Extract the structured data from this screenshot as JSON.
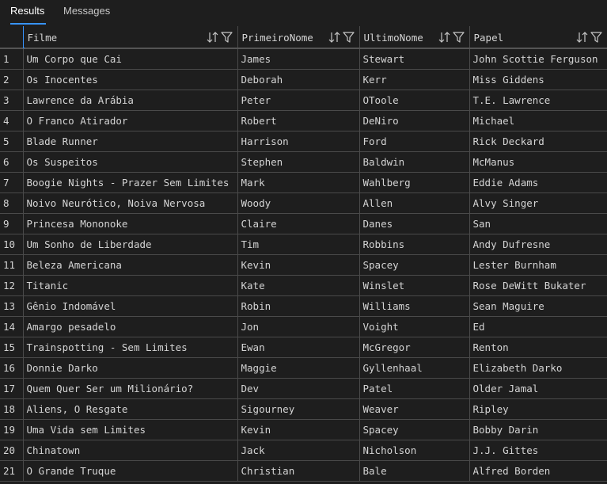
{
  "tabs": {
    "results": "Results",
    "messages": "Messages"
  },
  "columns": [
    "Filme",
    "PrimeiroNome",
    "UltimoNome",
    "Papel"
  ],
  "rows": [
    [
      "1",
      "Um Corpo que Cai",
      "James",
      "Stewart",
      "John Scottie Ferguson"
    ],
    [
      "2",
      "Os Inocentes",
      "Deborah",
      "Kerr",
      "Miss Giddens"
    ],
    [
      "3",
      "Lawrence da Arábia",
      "Peter",
      "OToole",
      "T.E. Lawrence"
    ],
    [
      "4",
      "O Franco Atirador",
      "Robert",
      "DeNiro",
      "Michael"
    ],
    [
      "5",
      "Blade Runner",
      "Harrison",
      "Ford",
      "Rick Deckard"
    ],
    [
      "6",
      "Os Suspeitos",
      "Stephen",
      "Baldwin",
      "McManus"
    ],
    [
      "7",
      "Boogie Nights - Prazer Sem Limites",
      "Mark",
      "Wahlberg",
      "Eddie Adams"
    ],
    [
      "8",
      "Noivo Neurótico, Noiva Nervosa",
      "Woody",
      "Allen",
      "Alvy Singer"
    ],
    [
      "9",
      "Princesa Mononoke",
      "Claire",
      "Danes",
      "San"
    ],
    [
      "10",
      "Um Sonho de Liberdade",
      "Tim",
      "Robbins",
      "Andy Dufresne"
    ],
    [
      "11",
      "Beleza Americana",
      "Kevin",
      "Spacey",
      "Lester Burnham"
    ],
    [
      "12",
      "Titanic",
      "Kate",
      "Winslet",
      "Rose DeWitt Bukater"
    ],
    [
      "13",
      "Gênio Indomável",
      "Robin",
      "Williams",
      "Sean Maguire"
    ],
    [
      "14",
      "Amargo pesadelo",
      "Jon",
      "Voight",
      "Ed"
    ],
    [
      "15",
      "Trainspotting - Sem Limites",
      "Ewan",
      "McGregor",
      "Renton"
    ],
    [
      "16",
      "Donnie Darko",
      "Maggie",
      "Gyllenhaal",
      "Elizabeth Darko"
    ],
    [
      "17",
      "Quem Quer Ser um Milionário?",
      "Dev",
      "Patel",
      "Older Jamal"
    ],
    [
      "18",
      "Aliens, O Resgate",
      "Sigourney",
      "Weaver",
      "Ripley"
    ],
    [
      "19",
      "Uma Vida sem Limites",
      "Kevin",
      "Spacey",
      "Bobby Darin"
    ],
    [
      "20",
      "Chinatown",
      "Jack",
      "Nicholson",
      "J.J. Gittes"
    ],
    [
      "21",
      "O Grande Truque",
      "Christian",
      "Bale",
      "Alfred Borden"
    ]
  ],
  "icons": {
    "sort": "sort-icon",
    "filter": "filter-icon"
  },
  "colors": {
    "background": "#1e1e1e",
    "accent": "#3794ff",
    "gridline": "#4a4a4a",
    "text": "#d4d4d4"
  }
}
